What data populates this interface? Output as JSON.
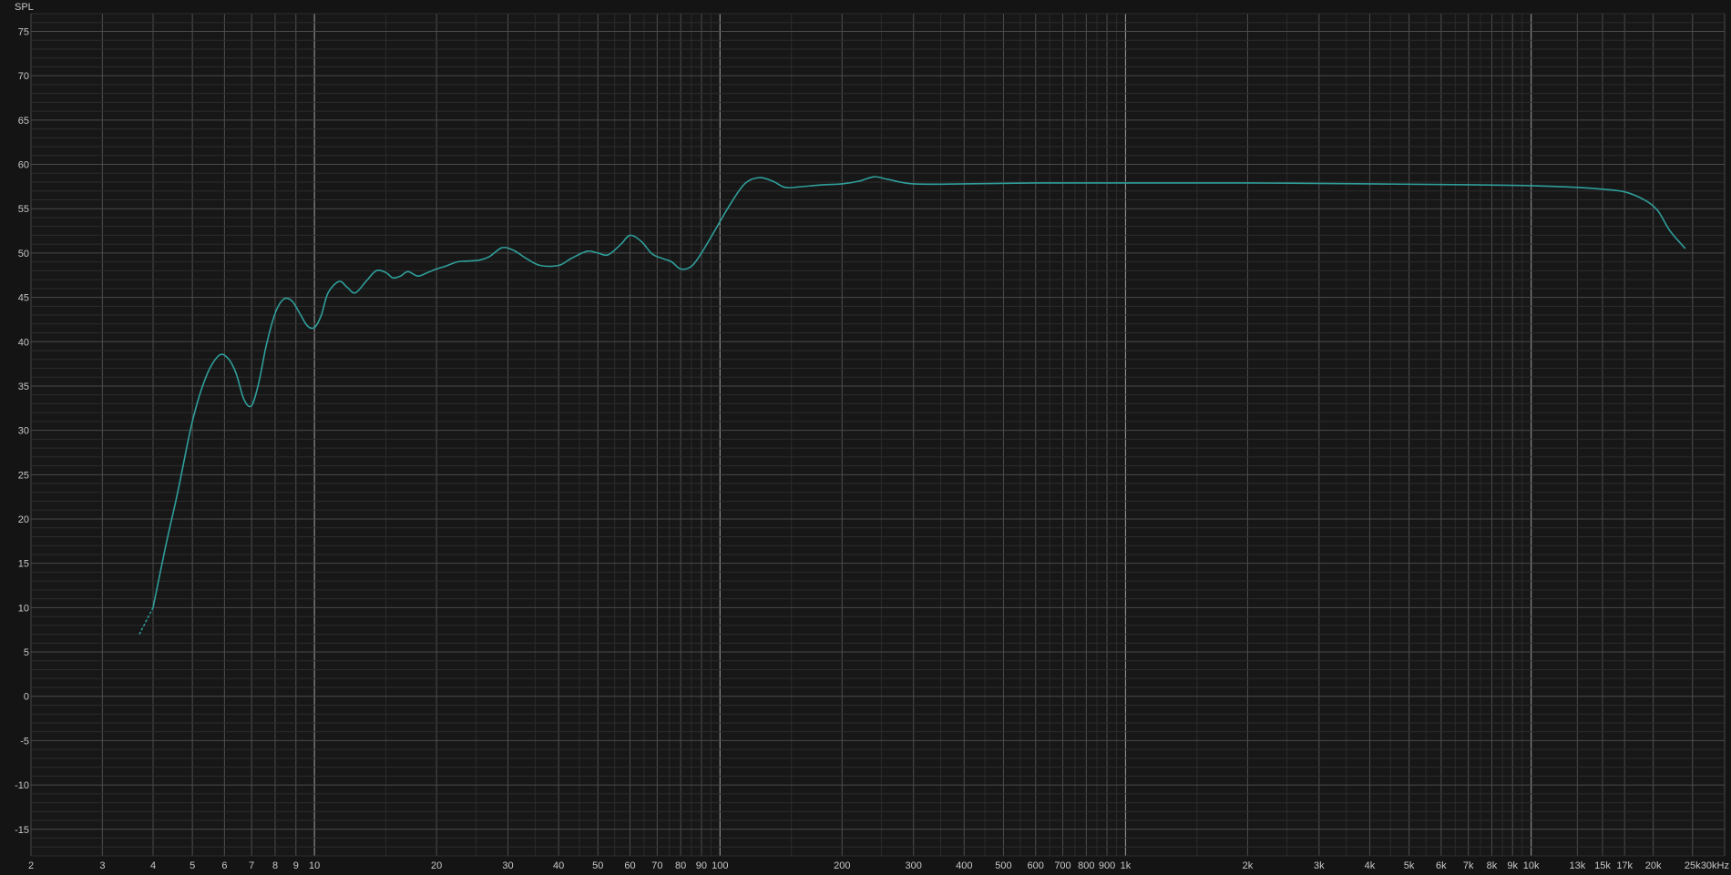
{
  "colors": {
    "background": "#141414",
    "plot_background": "#171717",
    "grid_minor": "#2c2c2c",
    "grid_major": "#4a4a4a",
    "grid_decade": "#8a8a8a",
    "curve": "#2f9e9a",
    "text": "#c8c8c8"
  },
  "chart_data": {
    "type": "line",
    "title": "",
    "xlabel": "",
    "ylabel": "SPL",
    "x_scale": "log",
    "xlim": [
      2,
      30000
    ],
    "ylim": [
      -18,
      77
    ],
    "grid": true,
    "y_ticks": [
      -15,
      -10,
      -5,
      0,
      5,
      10,
      15,
      20,
      25,
      30,
      35,
      40,
      45,
      50,
      55,
      60,
      65,
      70,
      75
    ],
    "y_tick_labels": [
      "-15",
      "-10",
      "-5",
      "0",
      "5",
      "10",
      "15",
      "20",
      "25",
      "30",
      "35",
      "40",
      "45",
      "50",
      "55",
      "60",
      "65",
      "70",
      "75"
    ],
    "x_ticks": [
      {
        "value": 2,
        "label": "2"
      },
      {
        "value": 3,
        "label": "3"
      },
      {
        "value": 4,
        "label": "4"
      },
      {
        "value": 5,
        "label": "5"
      },
      {
        "value": 6,
        "label": "6"
      },
      {
        "value": 7,
        "label": "7"
      },
      {
        "value": 8,
        "label": "8"
      },
      {
        "value": 9,
        "label": "9"
      },
      {
        "value": 10,
        "label": "10"
      },
      {
        "value": 20,
        "label": "20"
      },
      {
        "value": 30,
        "label": "30"
      },
      {
        "value": 40,
        "label": "40"
      },
      {
        "value": 50,
        "label": "50"
      },
      {
        "value": 60,
        "label": "60"
      },
      {
        "value": 70,
        "label": "70"
      },
      {
        "value": 80,
        "label": "80"
      },
      {
        "value": 90,
        "label": "90"
      },
      {
        "value": 100,
        "label": "100"
      },
      {
        "value": 200,
        "label": "200"
      },
      {
        "value": 300,
        "label": "300"
      },
      {
        "value": 400,
        "label": "400"
      },
      {
        "value": 500,
        "label": "500"
      },
      {
        "value": 600,
        "label": "600"
      },
      {
        "value": 700,
        "label": "700"
      },
      {
        "value": 800,
        "label": "800"
      },
      {
        "value": 900,
        "label": "900"
      },
      {
        "value": 1000,
        "label": "1k"
      },
      {
        "value": 2000,
        "label": "2k"
      },
      {
        "value": 3000,
        "label": "3k"
      },
      {
        "value": 4000,
        "label": "4k"
      },
      {
        "value": 5000,
        "label": "5k"
      },
      {
        "value": 6000,
        "label": "6k"
      },
      {
        "value": 7000,
        "label": "7k"
      },
      {
        "value": 8000,
        "label": "8k"
      },
      {
        "value": 9000,
        "label": "9k"
      },
      {
        "value": 10000,
        "label": "10k"
      },
      {
        "value": 13000,
        "label": "13k"
      },
      {
        "value": 15000,
        "label": "15k"
      },
      {
        "value": 17000,
        "label": "17k"
      },
      {
        "value": 20000,
        "label": "20k"
      },
      {
        "value": 25000,
        "label": "25k"
      },
      {
        "value": 30000,
        "label": "30kHz"
      }
    ],
    "series": [
      {
        "dashed_start": true,
        "x": [
          3.7,
          4.0,
          4.3,
          4.6,
          5.0,
          5.4,
          5.8,
          6.1,
          6.4,
          6.7,
          7.0,
          7.3,
          7.6,
          8.0,
          8.4,
          8.8,
          9.2,
          9.6,
          10.0,
          10.4,
          10.8,
          11.5,
          12.0,
          12.6,
          13.4,
          14.2,
          15.0,
          15.6,
          16.3,
          17.0,
          18.0,
          19.0,
          20.0,
          21.0,
          22.5,
          24.0,
          25.5,
          27.0,
          29.0,
          31.0,
          33.0,
          36.0,
          40.0,
          43.0,
          47.0,
          50.0,
          53.0,
          57.0,
          60.0,
          64.0,
          68.0,
          72.0,
          76.0,
          80.0,
          85.0,
          90.0,
          97.0,
          105.0,
          115.0,
          125.0,
          135.0,
          145.0,
          160.0,
          180.0,
          200.0,
          220.0,
          240.0,
          260.0,
          300.0,
          400.0,
          600.0,
          1000.0,
          2000.0,
          4000.0,
          7000.0,
          10000.0,
          13000.0,
          15000.0,
          17000.0,
          19000.0,
          20500.0,
          22000.0,
          24000.0
        ],
        "y": [
          7,
          10,
          17,
          23,
          31,
          36,
          38.4,
          38.2,
          36.5,
          33.5,
          32.8,
          35.5,
          39.5,
          43.2,
          44.8,
          44.6,
          43.2,
          41.8,
          41.6,
          43.0,
          45.5,
          46.8,
          46.2,
          45.5,
          46.8,
          48.0,
          47.8,
          47.2,
          47.4,
          47.9,
          47.4,
          47.8,
          48.2,
          48.5,
          49.0,
          49.1,
          49.2,
          49.6,
          50.6,
          50.3,
          49.5,
          48.6,
          48.6,
          49.4,
          50.2,
          50.0,
          49.8,
          51.0,
          52.0,
          51.3,
          49.9,
          49.4,
          49.0,
          48.2,
          48.5,
          50.0,
          52.5,
          55.2,
          57.8,
          58.5,
          58.1,
          57.4,
          57.5,
          57.7,
          57.8,
          58.1,
          58.6,
          58.3,
          57.8,
          57.8,
          57.9,
          57.9,
          57.9,
          57.8,
          57.7,
          57.6,
          57.4,
          57.2,
          56.9,
          56.0,
          54.8,
          52.5,
          50.5
        ]
      }
    ]
  }
}
